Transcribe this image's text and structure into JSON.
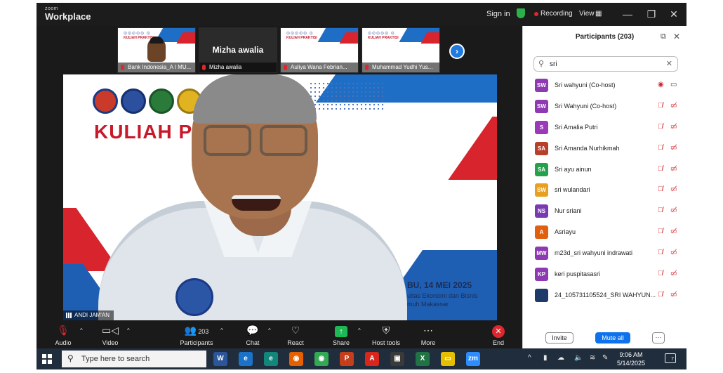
{
  "titlebar": {
    "logo_small": "zoom",
    "logo_big": "Workplace",
    "sign_in": "Sign in",
    "recording": "Recording",
    "view": "View",
    "view_icon": "grid-icon",
    "minimize": "—",
    "restore": "❐",
    "close": "✕"
  },
  "thumbnails": [
    {
      "caption": "Bank Indonesia_A I MU..."
    },
    {
      "name": "Mizha awalia",
      "caption": "Mizha awalia"
    },
    {
      "caption": "Auliya Wana Febrian..."
    },
    {
      "caption": "Muhammad Yudhi Yus..."
    }
  ],
  "thumb_brand": "KULIAH PRAKTISI",
  "thumb_seals": "⊙⊙⊙⊙⊙ ⊙",
  "next_arrow": "›",
  "video": {
    "title": "KULIAH PR",
    "date": "BU, 14 MEI 2025",
    "faculty1": "ultas Ekonomi dan Bisnis",
    "faculty2": "muh Makassar",
    "speaker": "ANDI JAM'AN"
  },
  "toolbar": {
    "audio": "Audio",
    "video": "Video",
    "participants": "Participants",
    "participants_count": "203",
    "chat": "Chat",
    "react": "React",
    "share": "Share",
    "host_tools": "Host tools",
    "more": "More",
    "end": "End"
  },
  "panel": {
    "title": "Participants (203)",
    "search_value": "sri",
    "invite": "Invite",
    "mute_all": "Mute all",
    "more": "···"
  },
  "participants": [
    {
      "initials": "SW",
      "name": "Sri wahyuni (Co-host)",
      "color": "#8e3ab2"
    },
    {
      "initials": "SW",
      "name": "Sri Wahyuni (Co-host)",
      "color": "#8e3ab2"
    },
    {
      "initials": "S",
      "name": "Sri Amalia Putri",
      "color": "#9a3ab8"
    },
    {
      "initials": "SA",
      "name": "Sri Amanda Nurhikmah",
      "color": "#b8402b"
    },
    {
      "initials": "SA",
      "name": "Sri ayu ainun",
      "color": "#25a04c"
    },
    {
      "initials": "SW",
      "name": "sri wulandari",
      "color": "#e8a020"
    },
    {
      "initials": "NS",
      "name": "Nur sriani",
      "color": "#7a3ab2"
    },
    {
      "initials": "A",
      "name": "Asriayu",
      "color": "#e06010"
    },
    {
      "initials": "MW",
      "name": "m23d_sri wahyuni indrawati",
      "color": "#8e3ab2"
    },
    {
      "initials": "KP",
      "name": "keri puspitasasri",
      "color": "#8e3ab2"
    },
    {
      "initials": "",
      "name": "24_105731105524_SRI WAHYUN...",
      "color": "#1d3a6a"
    }
  ],
  "taskbar": {
    "search_placeholder": "Type here to search",
    "time": "9:06 AM",
    "date": "5/14/2025",
    "notif_count": "7",
    "apps": [
      {
        "label": "W",
        "color": "#2b579a"
      },
      {
        "label": "e",
        "color": "#1a73c8"
      },
      {
        "label": "e",
        "color": "#12867a"
      },
      {
        "label": "◉",
        "color": "#e66000"
      },
      {
        "label": "◉",
        "color": "#34a853"
      },
      {
        "label": "P",
        "color": "#c43e1c"
      },
      {
        "label": "A",
        "color": "#d9261c"
      },
      {
        "label": "▣",
        "color": "#3a3a3a"
      },
      {
        "label": "X",
        "color": "#217346"
      },
      {
        "label": "▭",
        "color": "#e6c000"
      },
      {
        "label": "zm",
        "color": "#2d8cff"
      }
    ]
  }
}
